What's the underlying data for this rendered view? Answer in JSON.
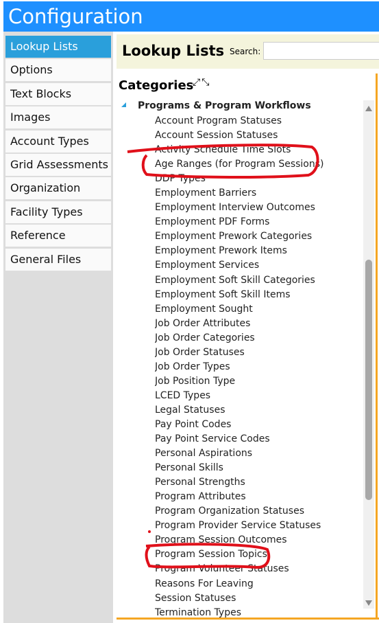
{
  "header": {
    "title": "Configuration"
  },
  "sidebar": {
    "items": [
      {
        "label": "Lookup Lists",
        "active": true
      },
      {
        "label": "Options"
      },
      {
        "label": "Text Blocks"
      },
      {
        "label": "Images"
      },
      {
        "label": "Account Types"
      },
      {
        "label": "Grid Assessments"
      },
      {
        "label": "Organization Types"
      },
      {
        "label": "Facility Types"
      },
      {
        "label": "Reference Libraries"
      },
      {
        "label": "General Files"
      }
    ]
  },
  "main": {
    "title": "Lookup Lists",
    "search_label": "Search:",
    "search_value": "",
    "categories_label": "Categories",
    "expand_icon": "expand-all-icon",
    "collapse_icon": "collapse-all-icon",
    "group": "Programs & Program Workflows",
    "items": [
      "Account Program Statuses",
      "Account Session Statuses",
      "Activity Schedule Time Slots",
      "Age Ranges (for Program Sessions)",
      "DDP Types",
      "Employment Barriers",
      "Employment Interview Outcomes",
      "Employment PDF Forms",
      "Employment Prework Categories",
      "Employment Prework Items",
      "Employment Services",
      "Employment Soft Skill Categories",
      "Employment Soft Skill Items",
      "Employment Sought",
      "Job Order Attributes",
      "Job Order Categories",
      "Job Order Statuses",
      "Job Order Types",
      "Job Position Type",
      "LCED Types",
      "Legal Statuses",
      "Pay Point Codes",
      "Pay Point Service Codes",
      "Personal Aspirations",
      "Personal Skills",
      "Personal Strengths",
      "Program Attributes",
      "Program Organization Statuses",
      "Program Provider Service Statuses",
      "Program Session Outcomes",
      "Program Session Topics",
      "Program Volunteer Statuses",
      "Reasons For Leaving",
      "Session Statuses",
      "Termination Types"
    ]
  },
  "colors": {
    "header": "#1e90ff",
    "active": "#2a9fdb",
    "accent_border": "#f5a623",
    "annotation": "#e0101a"
  }
}
